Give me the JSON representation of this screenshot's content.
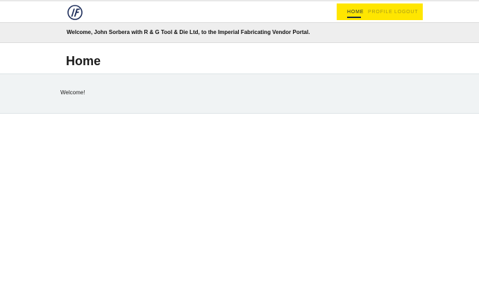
{
  "logo": {
    "icon": "imperial-fabricating-logo-icon",
    "color": "#1d2d5a"
  },
  "nav": {
    "background": "#ffe600",
    "items": [
      {
        "label": "HOME",
        "active": true
      },
      {
        "label": "PROFILE",
        "active": false
      },
      {
        "label": "LOGOUT",
        "active": false
      }
    ]
  },
  "welcome_bar": {
    "text": "Welcome, John Sorbera with R & G Tool & Die Ltd, to the Imperial Fabricating Vendor Portal."
  },
  "page": {
    "title": "Home",
    "body": "Welcome!"
  }
}
